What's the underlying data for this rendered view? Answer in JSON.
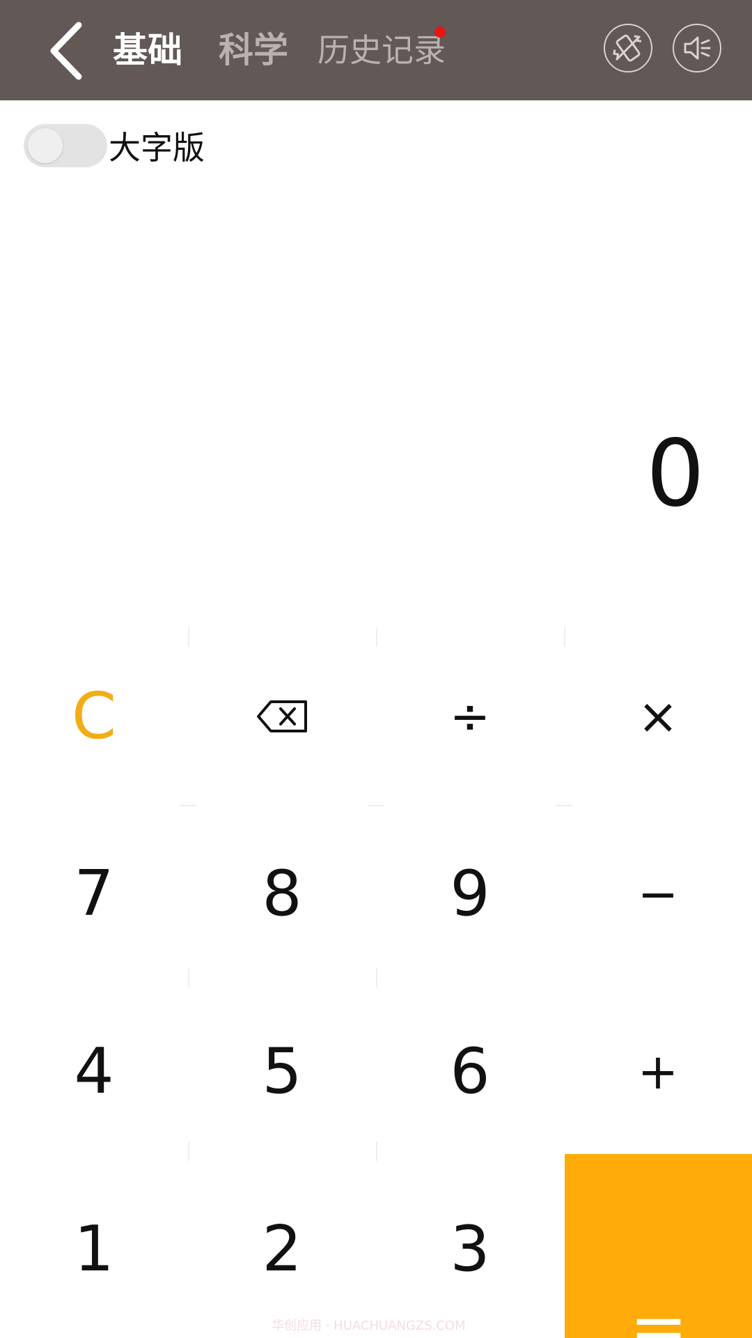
{
  "header": {
    "tabs": [
      {
        "label": "基础"
      },
      {
        "label": "科学"
      },
      {
        "label": "历史记录"
      }
    ],
    "history_badge_color": "#e81414",
    "icons": [
      "back-icon",
      "vibration-off-icon",
      "sound-off-icon"
    ]
  },
  "large_font": {
    "label": "大字版",
    "enabled": false
  },
  "display": {
    "value": "0"
  },
  "keypad": {
    "keys": [
      {
        "label": "C"
      },
      {
        "label": "⌫"
      },
      {
        "label": "÷"
      },
      {
        "label": "×"
      },
      {
        "label": "7"
      },
      {
        "label": "8"
      },
      {
        "label": "9"
      },
      {
        "label": "−"
      },
      {
        "label": "4"
      },
      {
        "label": "5"
      },
      {
        "label": "6"
      },
      {
        "label": "+"
      },
      {
        "label": "1"
      },
      {
        "label": "2"
      },
      {
        "label": "3"
      },
      {
        "label": "="
      }
    ]
  },
  "colors": {
    "header_bg": "#625856",
    "accent_orange": "#ffab09",
    "clear_key": "#f2ad16"
  },
  "watermark": "华创应用 · HUACHUANGZS.COM"
}
